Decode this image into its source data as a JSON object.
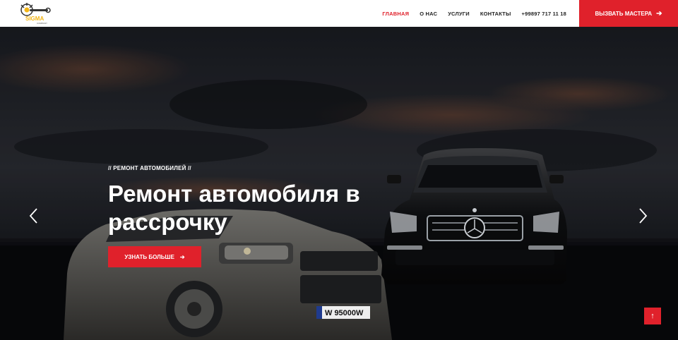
{
  "brand": {
    "name": "SIGMA",
    "tagline": "COMPANY",
    "color": "#e0212b"
  },
  "nav": {
    "items": [
      {
        "label": "ГЛАВНАЯ",
        "active": true
      },
      {
        "label": "О НАС",
        "active": false
      },
      {
        "label": "УСЛУГИ",
        "active": false
      },
      {
        "label": "КОНТАКТЫ",
        "active": false
      },
      {
        "label": "+99897 717 11 18",
        "active": false
      }
    ],
    "cta_label": "ВЫЗВАТЬ МАСТЕРА",
    "cta_icon": "arrow-right-icon"
  },
  "hero": {
    "eyebrow": "// РЕМОНТ АВТОМОБИЛЕЙ //",
    "title": "Ремонт автомобиля в рассрочку",
    "button_label": "УЗНАТЬ БОЛЬШЕ",
    "button_icon": "arrow-right-icon",
    "license_plate": "W 95000W",
    "prev_icon": "chevron-left-icon",
    "next_icon": "chevron-right-icon"
  },
  "to_top": {
    "icon": "arrow-up-icon",
    "symbol": "↑"
  },
  "colors": {
    "accent": "#e0212b",
    "header_bg": "#ffffff",
    "nav_text": "#222222"
  }
}
